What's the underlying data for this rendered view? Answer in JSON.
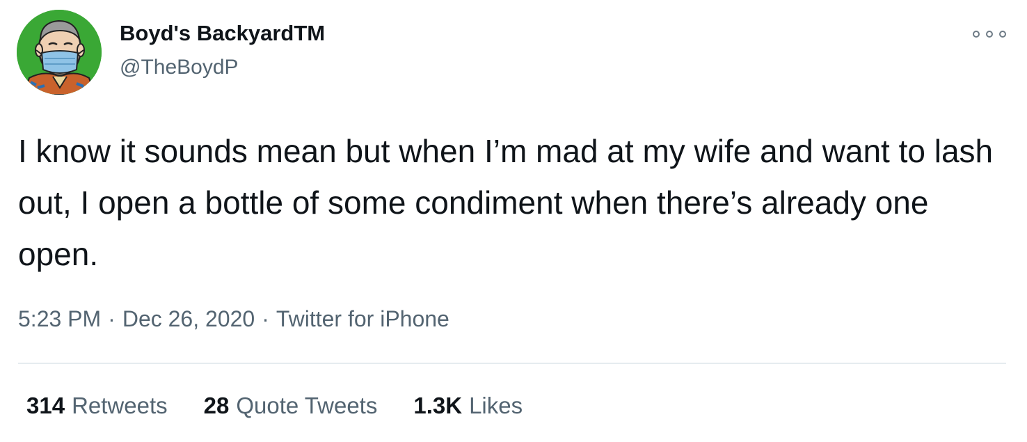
{
  "tweet": {
    "display_name": "Boyd's BackyardTM",
    "handle": "@TheBoydP",
    "text": "I know it sounds mean but when I’m mad at my wife and want to lash out, I open a bottle of some condiment when there’s already one open.",
    "time": "5:23 PM",
    "separator": "·",
    "date": "Dec 26, 2020",
    "source": "Twitter for iPhone",
    "more_icon": "more-options-icon",
    "avatar_icon": "avatar-masked-man-icon"
  },
  "stats": {
    "retweets_count": "314",
    "retweets_label": "Retweets",
    "quotes_count": "28",
    "quotes_label": "Quote Tweets",
    "likes_count": "1.3K",
    "likes_label": "Likes"
  },
  "colors": {
    "text_primary": "#0f1419",
    "text_secondary": "#536471",
    "divider": "#e6ecf0",
    "avatar_bg": "#3aa835"
  }
}
